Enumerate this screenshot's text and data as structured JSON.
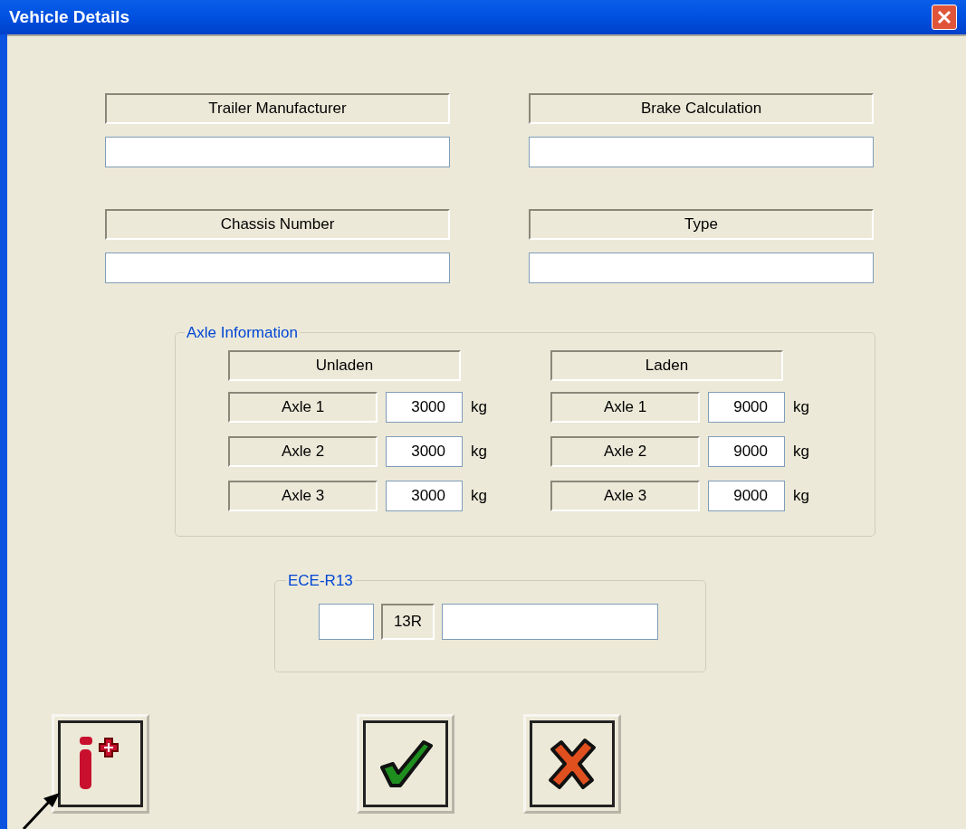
{
  "window": {
    "title": "Vehicle Details"
  },
  "fields": [
    {
      "label": "Trailer Manufacturer"
    },
    {
      "label": "Brake Calculation"
    },
    {
      "label": "Chassis Number"
    },
    {
      "label": "Type"
    }
  ],
  "axle_information": {
    "title": "Axle Information",
    "columns": [
      {
        "heading": "Unladen",
        "rows": [
          {
            "label": "Axle 1",
            "value": "3000",
            "unit": "kg"
          },
          {
            "label": "Axle 2",
            "value": "3000",
            "unit": "kg"
          },
          {
            "label": "Axle 3",
            "value": "3000",
            "unit": "kg"
          }
        ]
      },
      {
        "heading": "Laden",
        "rows": [
          {
            "label": "Axle 1",
            "value": "9000",
            "unit": "kg"
          },
          {
            "label": "Axle 2",
            "value": "9000",
            "unit": "kg"
          },
          {
            "label": "Axle 3",
            "value": "9000",
            "unit": "kg"
          }
        ]
      }
    ]
  },
  "ece_r13": {
    "title": "ECE-R13",
    "code": "13R"
  }
}
